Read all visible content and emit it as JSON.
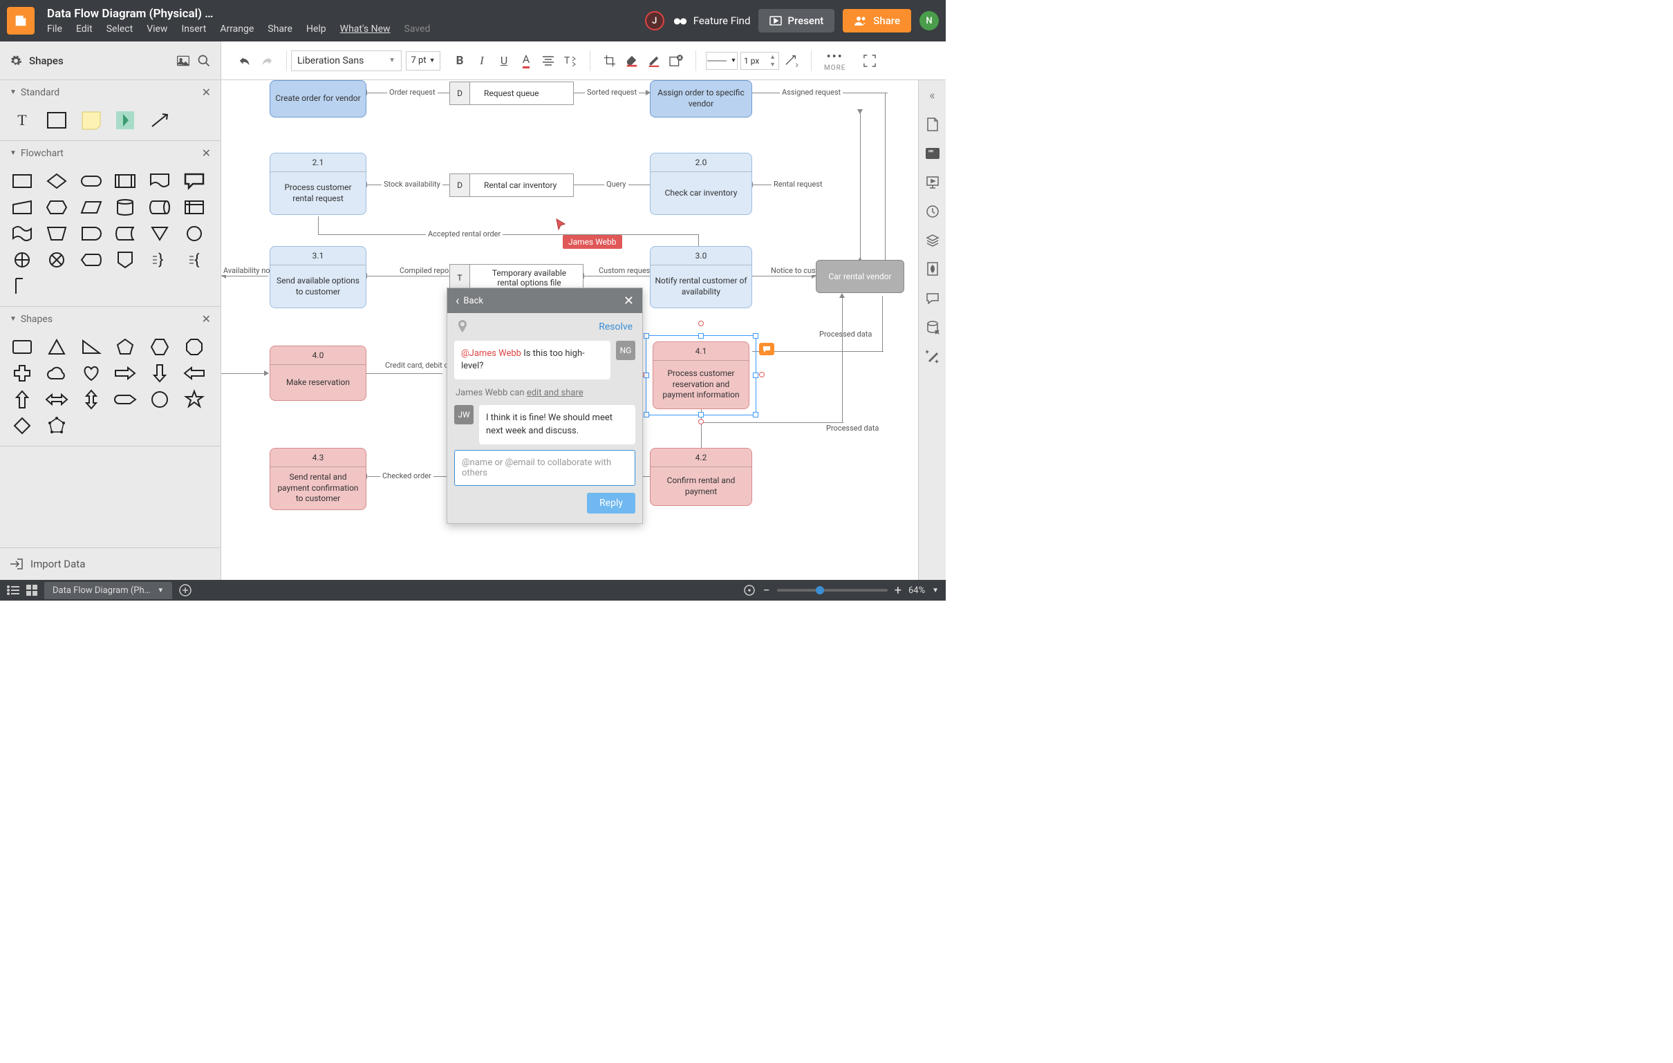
{
  "header": {
    "doc_title": "Data Flow Diagram (Physical) …",
    "menu": {
      "file": "File",
      "edit": "Edit",
      "select": "Select",
      "view": "View",
      "insert": "Insert",
      "arrange": "Arrange",
      "share": "Share",
      "help": "Help",
      "whatsnew": "What's New",
      "saved": "Saved"
    },
    "feature_find": "Feature Find",
    "present": "Present",
    "share_btn": "Share",
    "avatar_j": "J",
    "avatar_n": "N"
  },
  "shapes_panel": {
    "title": "Shapes",
    "import": "Import Data",
    "sections": {
      "standard": "Standard",
      "flowchart": "Flowchart",
      "shapes": "Shapes"
    }
  },
  "toolbar": {
    "font": "Liberation Sans",
    "font_size": "7 pt",
    "line_width": "1 px",
    "more": "MORE"
  },
  "canvas": {
    "nodes": {
      "create_order": {
        "body": "Create order for vendor"
      },
      "assign_order": {
        "body": "Assign order to specific vendor"
      },
      "n21": {
        "num": "2.1",
        "body": "Process customer rental request"
      },
      "n20": {
        "num": "2.0",
        "body": "Check car inventory"
      },
      "n31": {
        "num": "3.1",
        "body": "Send available options to customer"
      },
      "n30": {
        "num": "3.0",
        "body": "Notify rental customer of availability"
      },
      "n40": {
        "num": "4.0",
        "body": "Make reservation"
      },
      "n41": {
        "num": "4.1",
        "body": "Process customer reservation and payment information"
      },
      "n43": {
        "num": "4.3",
        "body": "Send rental and payment confirmation to customer"
      },
      "n42": {
        "num": "4.2",
        "body": "Confirm rental and payment"
      },
      "vendor": "Car rental vendor"
    },
    "datastores": {
      "request_queue": {
        "letter": "D",
        "label": "Request queue"
      },
      "inventory": {
        "letter": "D",
        "label": "Rental car inventory"
      },
      "temp_options": {
        "letter": "T",
        "label": "Temporary available rental options file"
      }
    },
    "edges": {
      "order_request": "Order request",
      "sorted_request": "Sorted request",
      "assigned_request": "Assigned request",
      "stock_availability": "Stock availability",
      "query": "Query",
      "rental_request": "Rental request",
      "accepted_rental_order": "Accepted rental order",
      "compiled_report": "Compiled report",
      "custom_request": "Custom request",
      "notice": "Notice to customer",
      "availability_notice": "Availability notice",
      "credit": "Credit card, debit card, or cash",
      "processed_data": "Processed data",
      "processed_data2": "Processed data",
      "checked_order": "Checked order"
    },
    "cursor_user": "James Webb"
  },
  "comments": {
    "back": "Back",
    "resolve": "Resolve",
    "msg1_mention": "@James Webb",
    "msg1_text": " Is this too high-level?",
    "msg1_av": "NG",
    "meta_user": "James Webb",
    "meta_can": " can ",
    "meta_action": "edit and share",
    "msg2_av": "JW",
    "msg2_text": "I think it is fine! We should meet next week and discuss.",
    "placeholder": "@name or @email to collaborate with others",
    "reply": "Reply"
  },
  "status": {
    "page_name": "Data Flow Diagram (Ph…",
    "zoom": "64%"
  }
}
